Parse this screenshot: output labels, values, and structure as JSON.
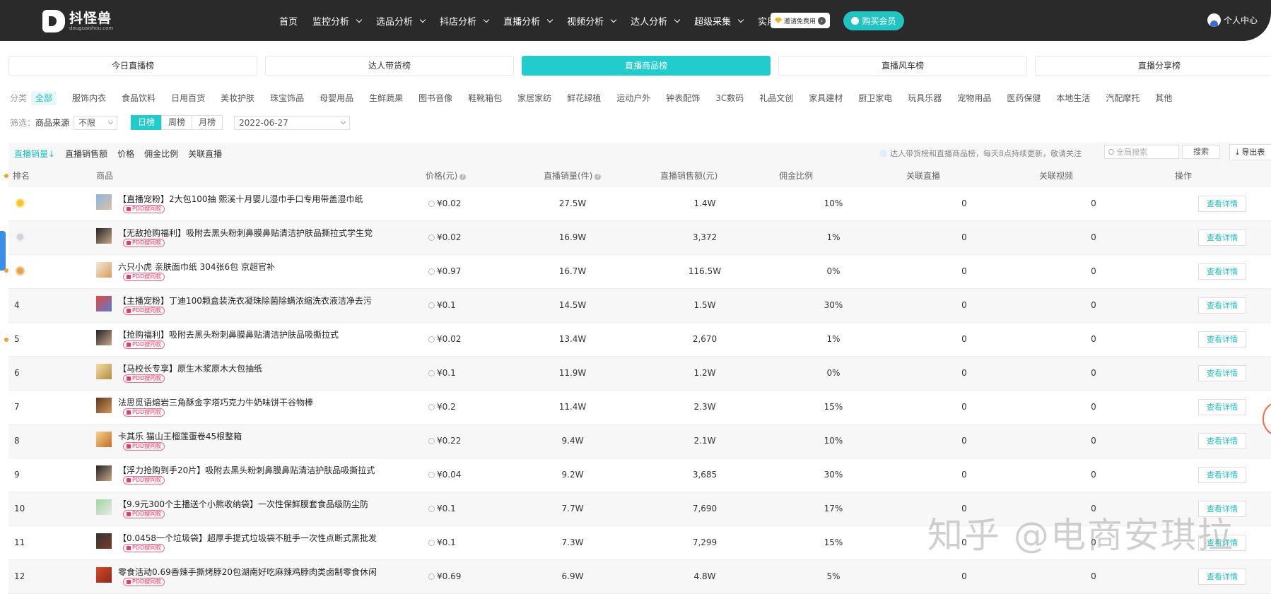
{
  "header": {
    "logo_name": "抖怪兽",
    "logo_url": "douguaishou.com",
    "nav": [
      "首页",
      "监控分析",
      "选品分析",
      "抖店分析",
      "直播分析",
      "视频分析",
      "达人分析",
      "超级采集",
      "实用工具"
    ],
    "invite": "邀请免费用",
    "buy": "购买会员",
    "user": "个人中心"
  },
  "tabs": [
    "今日直播榜",
    "达人带货榜",
    "直播商品榜",
    "直播风车榜",
    "直播分享榜"
  ],
  "categories": {
    "label": "分类",
    "items": [
      "全部",
      "服饰内衣",
      "食品饮料",
      "日用百货",
      "美妆护肤",
      "珠宝饰品",
      "母婴用品",
      "生鲜蔬果",
      "图书音像",
      "鞋靴箱包",
      "家居家纺",
      "鲜花绿植",
      "运动户外",
      "钟表配饰",
      "3C数码",
      "礼品文创",
      "家具建材",
      "厨卫家电",
      "玩具乐器",
      "宠物用品",
      "医药保健",
      "本地生活",
      "汽配摩托",
      "其他"
    ]
  },
  "filter": {
    "label": "筛选：",
    "source_label": "商品来源",
    "source_value": "不限",
    "periods": [
      "日榜",
      "周榜",
      "月榜"
    ],
    "date": "2022-06-27"
  },
  "toolbar": {
    "sort_tabs": [
      "直播销量↓",
      "直播销售额",
      "价格",
      "佣金比例",
      "关联直播"
    ],
    "note": "达人带货榜和直播商品榜，每天8点持续更新，敬请关注",
    "search_placeholder": "全局搜索",
    "search_btn": "搜索",
    "export": "导出表"
  },
  "table": {
    "headers": [
      "排名",
      "商品",
      "价格(元)",
      "直播销量(件)",
      "直播销售额(元)",
      "佣金比例",
      "关联直播",
      "关联视频",
      "操作"
    ],
    "badge": "PDD搜同款",
    "action": "查看详情",
    "rows": [
      {
        "rank": "1",
        "name": "【直播宠粉】2大包100抽 熙溪十月婴儿湿巾手口专用带盖湿巾纸",
        "price": "¥0.02",
        "sales": "27.5W",
        "revenue": "1.4W",
        "commission": "10%",
        "live": "0",
        "video": "0"
      },
      {
        "rank": "2",
        "name": "【无敌抢购福利】吸附去黑头粉刺鼻膜鼻贴清洁护肤品撕拉式学生党",
        "price": "¥0.02",
        "sales": "16.9W",
        "revenue": "3,372",
        "commission": "1%",
        "live": "0",
        "video": "0"
      },
      {
        "rank": "3",
        "name": "六只小虎 亲肤面巾纸 304张6包 京超官补",
        "price": "¥0.97",
        "sales": "16.7W",
        "revenue": "116.5W",
        "commission": "0%",
        "live": "0",
        "video": "0"
      },
      {
        "rank": "4",
        "name": "【主播宠粉】丁迪100颗盒装洗衣凝珠除菌除螨浓缩洗衣液洁净去污",
        "price": "¥0.1",
        "sales": "14.5W",
        "revenue": "1.5W",
        "commission": "30%",
        "live": "0",
        "video": "0"
      },
      {
        "rank": "5",
        "name": "【抢购福利】吸附去黑头粉刺鼻膜鼻贴清洁护肤品吸撕拉式",
        "price": "¥0.02",
        "sales": "13.4W",
        "revenue": "2,670",
        "commission": "1%",
        "live": "0",
        "video": "0"
      },
      {
        "rank": "6",
        "name": "【马校长专享】原生木浆原木大包抽纸",
        "price": "¥0.1",
        "sales": "11.9W",
        "revenue": "1.2W",
        "commission": "0%",
        "live": "0",
        "video": "0"
      },
      {
        "rank": "7",
        "name": "法思觅语熔岩三角酥金字塔巧克力牛奶味饼干谷物棒",
        "price": "¥0.2",
        "sales": "11.4W",
        "revenue": "2.3W",
        "commission": "15%",
        "live": "0",
        "video": "0"
      },
      {
        "rank": "8",
        "name": "卡其乐 猫山王榴莲蛋卷45根整箱",
        "price": "¥0.22",
        "sales": "9.4W",
        "revenue": "2.1W",
        "commission": "10%",
        "live": "0",
        "video": "0"
      },
      {
        "rank": "9",
        "name": "【浮力抢购到手20片】吸附去黑头粉刺鼻膜鼻贴清洁护肤品吸撕拉式",
        "price": "¥0.04",
        "sales": "9.2W",
        "revenue": "3,685",
        "commission": "30%",
        "live": "0",
        "video": "0"
      },
      {
        "rank": "10",
        "name": "【9.9元300个主播送个小熊收纳袋】一次性保鲜膜套食品级防尘防",
        "price": "¥0.1",
        "sales": "7.7W",
        "revenue": "7,690",
        "commission": "17%",
        "live": "0",
        "video": "0"
      },
      {
        "rank": "11",
        "name": "【0.0458一个垃圾袋】超厚手提式垃圾袋不脏手一次性点断式黑批发",
        "price": "¥0.1",
        "sales": "7.3W",
        "revenue": "7,299",
        "commission": "15%",
        "live": "0",
        "video": "0"
      },
      {
        "rank": "12",
        "name": "零食活动0.69香辣手撕烤脖20包湖南好吃麻辣鸡脖肉类卤制零食休闲",
        "price": "¥0.69",
        "sales": "6.9W",
        "revenue": "4.8W",
        "commission": "5%",
        "live": "0",
        "video": "0"
      }
    ]
  },
  "watermark": "知乎 @电商安琪拉"
}
